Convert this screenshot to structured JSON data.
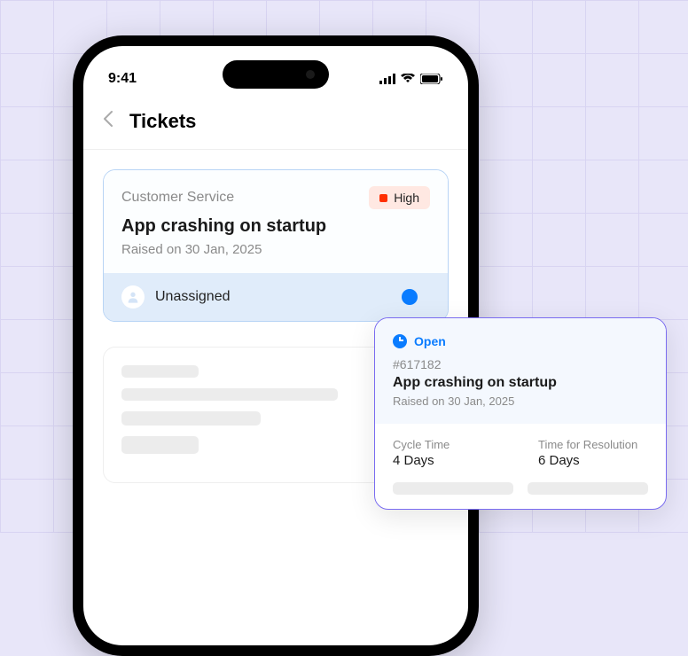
{
  "status_bar": {
    "time": "9:41"
  },
  "header": {
    "title": "Tickets"
  },
  "ticket": {
    "category": "Customer Service",
    "priority": "High",
    "title": "App crashing on startup",
    "raised": "Raised on 30 Jan, 2025",
    "assignee": "Unassigned"
  },
  "detail": {
    "status": "Open",
    "id": "#617182",
    "title": "App crashing on startup",
    "raised": "Raised on 30 Jan, 2025",
    "cycle_label": "Cycle Time",
    "cycle_value": "4 Days",
    "resolution_label": "Time for Resolution",
    "resolution_value": "6 Days"
  }
}
